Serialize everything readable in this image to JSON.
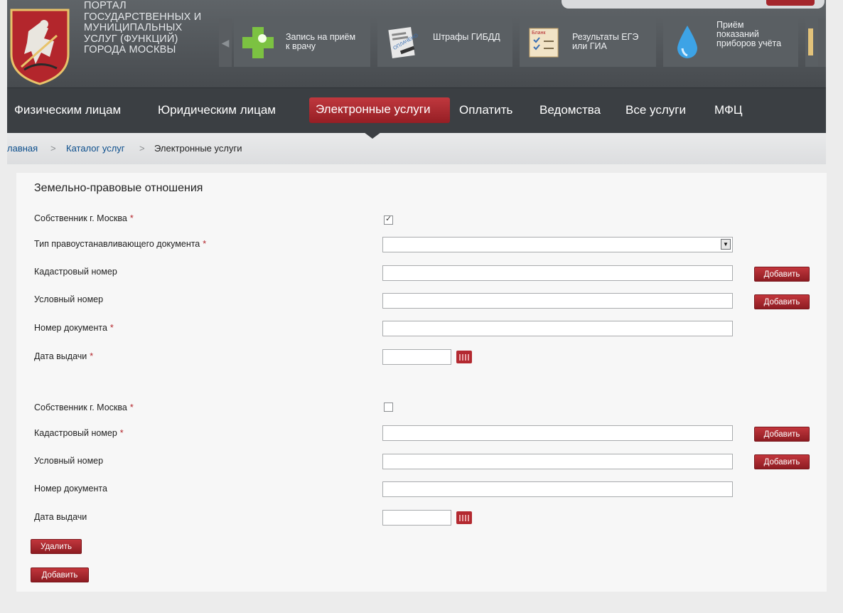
{
  "header": {
    "portal_title": [
      "ПОРТАЛ",
      "ГОСУДАРСТВЕННЫХ И",
      "МУНИЦИПАЛЬНЫХ",
      "УСЛУГ (ФУНКЦИЙ)",
      "ГОРОДА МОСКВЫ"
    ],
    "emblem_icon": "moscow-coat-of-arms-icon",
    "promos": [
      {
        "label": [
          "Запись на приём",
          "к врачу"
        ],
        "icon": "green-cross-icon"
      },
      {
        "label": [
          "Штрафы ГИБДД"
        ],
        "icon": "fine-document-icon",
        "stamp": "ОПЛАЧЕНО"
      },
      {
        "label": [
          "Результаты ЕГЭ",
          "или ГИА"
        ],
        "icon": "exam-form-icon",
        "form_title": "Бланк"
      },
      {
        "label": [
          "Приём",
          "показаний",
          "приборов учёта"
        ],
        "icon": "water-drop-icon"
      }
    ]
  },
  "nav": {
    "items": [
      "Физическим лицам",
      "Юридическим лицам",
      "Электронные услуги",
      "Оплатить",
      "Ведомства",
      "Все услуги",
      "МФЦ"
    ],
    "active": "Электронные услуги"
  },
  "breadcrumbs": {
    "home": "лавная",
    "separator": ">",
    "catalog": "Каталог услуг",
    "current": "Электронные услуги"
  },
  "form": {
    "title": "Земельно-правовые отношения",
    "required_mark": "*",
    "add_label": "Добавить",
    "block1": {
      "owner": "Собственник г. Москва",
      "owner_checked": true,
      "doc_type": "Тип правоустанавливающего документа",
      "doc_type_value": "",
      "cadastral": "Кадастровый номер",
      "conditional": "Условный номер",
      "doc_number": "Номер документа",
      "issue_date": "Дата выдачи"
    },
    "block2": {
      "owner": "Собственник г. Москва",
      "owner_checked": false,
      "cadastral": "Кадастровый номер",
      "conditional": "Условный номер",
      "doc_number": "Номер документа",
      "issue_date": "Дата выдачи"
    },
    "delete_label": "Удалить",
    "add_block_label": "Добавить"
  },
  "colors": {
    "accent": "#a4262c",
    "nav_bg": "#3b3f43",
    "link": "#0b4e8c"
  }
}
